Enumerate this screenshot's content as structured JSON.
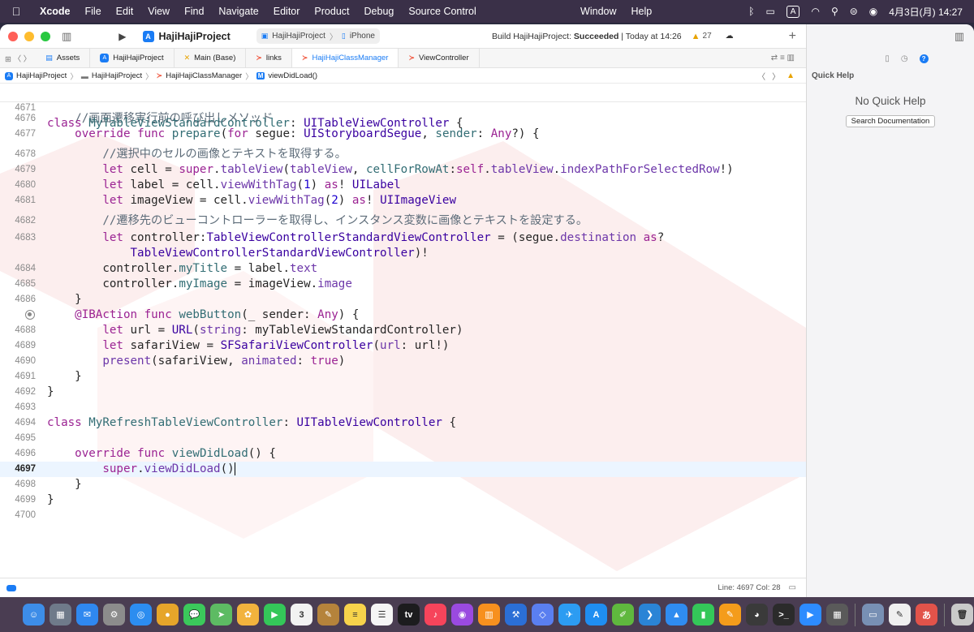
{
  "menubar": {
    "app_name": "Xcode",
    "items": [
      "File",
      "Edit",
      "View",
      "Find",
      "Navigate",
      "Editor",
      "Product",
      "Debug",
      "Source Control"
    ],
    "window_menu": "Window",
    "help_menu": "Help",
    "input_source": "A",
    "datetime": "4月3日(月)  14:27"
  },
  "toolbar": {
    "scheme": "HajiHajiProject",
    "destination_project": "HajiHajiProject",
    "destination_device": "iPhone",
    "build_status_prefix": "Build HajiHajiProject: ",
    "build_status_result": "Succeeded",
    "build_status_time": " | Today at 14:26",
    "warning_count": "27"
  },
  "tabs": [
    {
      "label": "Assets",
      "icon": "folder-icon"
    },
    {
      "label": "HajiHajiProject",
      "icon": "app-icon"
    },
    {
      "label": "Main (Base)",
      "icon": "storyboard-icon"
    },
    {
      "label": "links",
      "icon": "swift-icon"
    },
    {
      "label": "HajiHajiClassManager",
      "icon": "swift-icon",
      "active": true
    },
    {
      "label": "ViewController",
      "icon": "swift-icon"
    }
  ],
  "jumpbar": {
    "project": "HajiHajiProject",
    "group": "HajiHajiProject",
    "file": "HajiHajiClassManager",
    "symbol_badge": "M",
    "symbol": "viewDidLoad()"
  },
  "editor": {
    "sticky": {
      "number": "4671",
      "code": "class MyTableViewStandardController: UITableViewController {"
    },
    "lines": [
      {
        "n": "4676",
        "tokens": [
          [
            "    ",
            ""
          ],
          [
            "//画面遷移実行前の呼び出しメソッド",
            "cm"
          ]
        ]
      },
      {
        "n": "4677",
        "tokens": [
          [
            "    ",
            ""
          ],
          [
            "override",
            "kw"
          ],
          [
            " ",
            ""
          ],
          [
            "func",
            "kw"
          ],
          [
            " ",
            ""
          ],
          [
            "prepare",
            "fn"
          ],
          [
            "(",
            ""
          ],
          [
            "for",
            "kw"
          ],
          [
            " segue: ",
            ""
          ],
          [
            "UIStoryboardSegue",
            "ty"
          ],
          [
            ", ",
            ""
          ],
          [
            "sender",
            "fn"
          ],
          [
            ": ",
            ""
          ],
          [
            "Any",
            "kw"
          ],
          [
            "?) {",
            ""
          ]
        ]
      },
      {
        "n": "4678",
        "tokens": [
          [
            "        ",
            ""
          ],
          [
            "//選択中のセルの画像とテキストを取得する。",
            "cm"
          ]
        ]
      },
      {
        "n": "4679",
        "tokens": [
          [
            "        ",
            ""
          ],
          [
            "let",
            "kw"
          ],
          [
            " cell = ",
            ""
          ],
          [
            "super",
            "kw"
          ],
          [
            ".",
            ""
          ],
          [
            "tableView",
            "prop"
          ],
          [
            "(",
            ""
          ],
          [
            "tableView",
            "prop"
          ],
          [
            ", ",
            ""
          ],
          [
            "cellForRowAt",
            "fn"
          ],
          [
            ":",
            ""
          ],
          [
            "self",
            "kw"
          ],
          [
            ".",
            ""
          ],
          [
            "tableView",
            "prop"
          ],
          [
            ".",
            ""
          ],
          [
            "indexPathForSelectedRow",
            "prop"
          ],
          [
            "!)",
            ""
          ]
        ]
      },
      {
        "n": "4680",
        "tokens": [
          [
            "        ",
            ""
          ],
          [
            "let",
            "kw"
          ],
          [
            " label = cell.",
            ""
          ],
          [
            "viewWithTag",
            "prop"
          ],
          [
            "(",
            ""
          ],
          [
            "1",
            "num"
          ],
          [
            ") ",
            ""
          ],
          [
            "as",
            "kw"
          ],
          [
            "! ",
            ""
          ],
          [
            "UILabel",
            "ty"
          ]
        ]
      },
      {
        "n": "4681",
        "tokens": [
          [
            "        ",
            ""
          ],
          [
            "let",
            "kw"
          ],
          [
            " imageView = cell.",
            ""
          ],
          [
            "viewWithTag",
            "prop"
          ],
          [
            "(",
            ""
          ],
          [
            "2",
            "num"
          ],
          [
            ") ",
            ""
          ],
          [
            "as",
            "kw"
          ],
          [
            "! ",
            ""
          ],
          [
            "UIImageView",
            "ty"
          ]
        ]
      },
      {
        "n": "4682",
        "tokens": [
          [
            "        ",
            ""
          ],
          [
            "//遷移先のビューコントローラーを取得し、インスタンス変数に画像とテキストを設定する。",
            "cm"
          ]
        ]
      },
      {
        "n": "4683",
        "tokens": [
          [
            "        ",
            ""
          ],
          [
            "let",
            "kw"
          ],
          [
            " controller:",
            ""
          ],
          [
            "TableViewControllerStandardViewController",
            "ty"
          ],
          [
            " = (segue.",
            ""
          ],
          [
            "destination",
            "prop"
          ],
          [
            " ",
            ""
          ],
          [
            "as",
            "kw"
          ],
          [
            "?",
            ""
          ]
        ]
      },
      {
        "n": "",
        "tokens": [
          [
            "            ",
            ""
          ],
          [
            "TableViewControllerStandardViewController",
            "ty"
          ],
          [
            ")!",
            ""
          ]
        ]
      },
      {
        "n": "4684",
        "tokens": [
          [
            "        ",
            ""
          ],
          [
            "controller.",
            ""
          ],
          [
            "myTitle",
            "fn"
          ],
          [
            " = label.",
            ""
          ],
          [
            "text",
            "prop"
          ]
        ]
      },
      {
        "n": "4685",
        "tokens": [
          [
            "        ",
            ""
          ],
          [
            "controller.",
            ""
          ],
          [
            "myImage",
            "fn"
          ],
          [
            " = imageView.",
            ""
          ],
          [
            "image",
            "prop"
          ]
        ]
      },
      {
        "n": "4686",
        "tokens": [
          [
            "    }",
            ""
          ]
        ]
      },
      {
        "n": "",
        "breakpoint": true,
        "tokens": [
          [
            "    ",
            ""
          ],
          [
            "@IBAction",
            "kw"
          ],
          [
            " ",
            ""
          ],
          [
            "func",
            "kw"
          ],
          [
            " ",
            ""
          ],
          [
            "webButton",
            "fn"
          ],
          [
            "(_ sender: ",
            ""
          ],
          [
            "Any",
            "kw"
          ],
          [
            ") {",
            ""
          ]
        ]
      },
      {
        "n": "4688",
        "tokens": [
          [
            "        ",
            ""
          ],
          [
            "let",
            "kw"
          ],
          [
            " url = ",
            ""
          ],
          [
            "URL",
            "ty"
          ],
          [
            "(",
            ""
          ],
          [
            "string",
            "prop"
          ],
          [
            ": myTableViewStandardController)",
            ""
          ]
        ]
      },
      {
        "n": "4689",
        "tokens": [
          [
            "        ",
            ""
          ],
          [
            "let",
            "kw"
          ],
          [
            " safariView = ",
            ""
          ],
          [
            "SFSafariViewController",
            "ty"
          ],
          [
            "(",
            ""
          ],
          [
            "url",
            "prop"
          ],
          [
            ": url!)",
            ""
          ]
        ]
      },
      {
        "n": "4690",
        "tokens": [
          [
            "        ",
            ""
          ],
          [
            "present",
            "prop"
          ],
          [
            "(safariView, ",
            ""
          ],
          [
            "animated",
            "prop"
          ],
          [
            ": ",
            ""
          ],
          [
            "true",
            "kw"
          ],
          [
            ")",
            ""
          ]
        ]
      },
      {
        "n": "4691",
        "tokens": [
          [
            "    }",
            ""
          ]
        ]
      },
      {
        "n": "4692",
        "tokens": [
          [
            "}",
            ""
          ]
        ]
      },
      {
        "n": "4693",
        "tokens": []
      },
      {
        "n": "4694",
        "tokens": [
          [
            "class",
            "kw"
          ],
          [
            " ",
            ""
          ],
          [
            "MyRefreshTableViewController",
            "fn"
          ],
          [
            ": ",
            ""
          ],
          [
            "UITableViewController",
            "ty"
          ],
          [
            " {",
            ""
          ]
        ]
      },
      {
        "n": "4695",
        "tokens": []
      },
      {
        "n": "4696",
        "tokens": [
          [
            "    ",
            ""
          ],
          [
            "override",
            "kw"
          ],
          [
            " ",
            ""
          ],
          [
            "func",
            "kw"
          ],
          [
            " ",
            ""
          ],
          [
            "viewDidLoad",
            "fn"
          ],
          [
            "() {",
            ""
          ]
        ]
      },
      {
        "n": "4697",
        "current": true,
        "tokens": [
          [
            "        ",
            ""
          ],
          [
            "super",
            "kw"
          ],
          [
            ".",
            ""
          ],
          [
            "viewDidLoad",
            "prop"
          ],
          [
            "()",
            ""
          ]
        ]
      },
      {
        "n": "4698",
        "tokens": [
          [
            "    }",
            ""
          ]
        ]
      },
      {
        "n": "4699",
        "tokens": [
          [
            "}",
            ""
          ]
        ]
      },
      {
        "n": "4700",
        "tokens": []
      }
    ]
  },
  "statusbar": {
    "cursor_position": "Line: 4697  Col: 28"
  },
  "inspector": {
    "title": "Quick Help",
    "empty_message": "No Quick Help",
    "search_button": "Search Documentation"
  },
  "colors": {
    "accent": "#1a7cf5",
    "keyword": "#9b2393",
    "type": "#3900a0",
    "comment": "#5d6c79"
  },
  "dock": [
    {
      "name": "finder-icon",
      "color": "#3d8de8",
      "glyph": "☺"
    },
    {
      "name": "launchpad-icon",
      "color": "#6f7a8a",
      "glyph": "▦"
    },
    {
      "name": "mail-icon",
      "color": "#2f88f0",
      "glyph": "✉"
    },
    {
      "name": "system-settings-icon",
      "color": "#8c8c8c",
      "glyph": "⚙"
    },
    {
      "name": "safari-icon",
      "color": "#2c8df0",
      "glyph": "◎"
    },
    {
      "name": "chrome-icon",
      "color": "#e6a52a",
      "glyph": "●"
    },
    {
      "name": "messages-icon",
      "color": "#3bc95b",
      "glyph": "💬"
    },
    {
      "name": "maps-icon",
      "color": "#5dbb63",
      "glyph": "➤"
    },
    {
      "name": "photos-icon",
      "color": "#f2b33d",
      "glyph": "✿"
    },
    {
      "name": "facetime-icon",
      "color": "#34c759",
      "glyph": "▶"
    },
    {
      "name": "calendar-icon",
      "color": "#f2f2f2",
      "glyph": "3"
    },
    {
      "name": "notes-app-icon",
      "color": "#b5833b",
      "glyph": "✎"
    },
    {
      "name": "notes-icon",
      "color": "#f7d34b",
      "glyph": "≡"
    },
    {
      "name": "reminders-icon",
      "color": "#f5f5f5",
      "glyph": "☰"
    },
    {
      "name": "tv-icon",
      "color": "#1c1c1e",
      "glyph": "tv"
    },
    {
      "name": "music-icon",
      "color": "#f6445b",
      "glyph": "♪"
    },
    {
      "name": "podcasts-icon",
      "color": "#9a4ae0",
      "glyph": "◉"
    },
    {
      "name": "books-icon",
      "color": "#f7901e",
      "glyph": "▥"
    },
    {
      "name": "xcode-icon",
      "color": "#2b6fd6",
      "glyph": "⚒"
    },
    {
      "name": "simulator-icon",
      "color": "#5a7ff0",
      "glyph": "◇"
    },
    {
      "name": "testflight-icon",
      "color": "#2c9cf2",
      "glyph": "✈"
    },
    {
      "name": "app-store-icon",
      "color": "#1f8ef1",
      "glyph": "A"
    },
    {
      "name": "xcode-beta-icon",
      "color": "#5fb83e",
      "glyph": "✐"
    },
    {
      "name": "vscode-icon",
      "color": "#2a84d6",
      "glyph": "❯"
    },
    {
      "name": "keynote-icon",
      "color": "#2f8cf0",
      "glyph": "▲"
    },
    {
      "name": "numbers-icon",
      "color": "#34c759",
      "glyph": "▮"
    },
    {
      "name": "pages-icon",
      "color": "#f49c1b",
      "glyph": "✎"
    },
    {
      "name": "github-desktop-icon",
      "color": "#3a3a3a",
      "glyph": "◕"
    },
    {
      "name": "terminal-icon",
      "color": "#2b2b2b",
      "glyph": ">_"
    },
    {
      "name": "zoom-icon",
      "color": "#2d8cff",
      "glyph": "▶"
    },
    {
      "name": "calculator-icon",
      "color": "#5a5a5a",
      "glyph": "▦"
    },
    {
      "name": "preview-icon",
      "color": "#7890b4",
      "glyph": "▭"
    },
    {
      "name": "textedit-icon",
      "color": "#efefef",
      "glyph": "✎"
    },
    {
      "name": "kotoeri-icon",
      "color": "#e2534a",
      "glyph": "あ"
    },
    {
      "name": "trash-icon",
      "color": "#c9c9c9",
      "glyph": "🗑"
    }
  ]
}
